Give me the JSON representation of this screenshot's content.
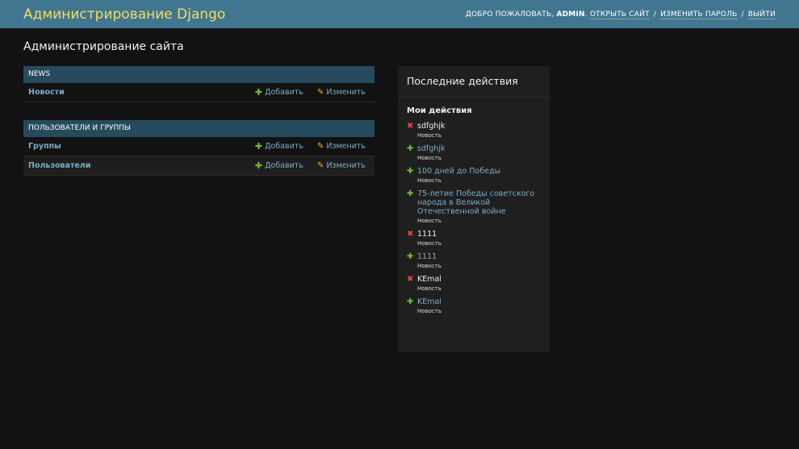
{
  "header": {
    "branding": "Администрирование Django",
    "welcome": "Добро пожаловать,",
    "username": "admin",
    "view_site": "Открыть сайт",
    "change_password": "Изменить пароль",
    "logout": "Выйти",
    "separator": "/"
  },
  "page": {
    "title": "Администрирование сайта"
  },
  "modules": [
    {
      "caption": "News",
      "rows": [
        {
          "name": "Новости",
          "add": "Добавить",
          "change": "Изменить"
        }
      ]
    },
    {
      "caption": "Пользователи и группы",
      "rows": [
        {
          "name": "Группы",
          "add": "Добавить",
          "change": "Изменить"
        },
        {
          "name": "Пользователи",
          "add": "Добавить",
          "change": "Изменить"
        }
      ]
    }
  ],
  "recent_actions": {
    "title": "Последние действия",
    "subtitle": "Мои действия",
    "items": [
      {
        "action": "delete",
        "object": "sdfghjk",
        "type": "Новость"
      },
      {
        "action": "add",
        "object": "sdfghjk",
        "type": "Новость"
      },
      {
        "action": "add",
        "object": "100 дней до Победы",
        "type": "Новость"
      },
      {
        "action": "add",
        "object": "75-летие Победы советского народа в Великой Отечественной войне",
        "type": "Новость"
      },
      {
        "action": "delete",
        "object": "1111",
        "type": "Новость"
      },
      {
        "action": "add",
        "object": "1111",
        "type": "Новость"
      },
      {
        "action": "delete",
        "object": "KEmal",
        "type": "Новость"
      },
      {
        "action": "add",
        "object": "KEmal",
        "type": "Новость"
      }
    ]
  },
  "icons": {
    "add": "plus-icon",
    "change": "pencil-icon",
    "delete": "x-icon"
  },
  "colors": {
    "header": "#417690",
    "branding": "#f5dd5d",
    "caption": "#264b5d",
    "link": "#79aec8",
    "add": "#70bf2b",
    "delete": "#dd4646",
    "change": "#efb80b"
  }
}
